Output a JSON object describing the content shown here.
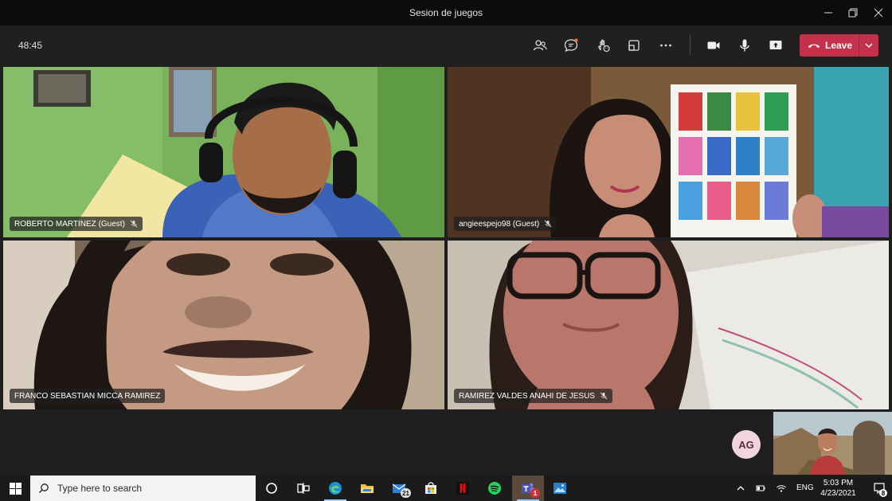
{
  "window": {
    "title": "Sesion de juegos",
    "controls": [
      "minimize-icon",
      "restore-icon",
      "close-icon"
    ]
  },
  "toolbar": {
    "timer": "48:45",
    "buttons": [
      "participants-icon",
      "chat-icon",
      "reactions-icon",
      "rooms-icon",
      "more-icon",
      "camera-icon",
      "mic-icon",
      "share-icon"
    ],
    "leave_label": "Leave",
    "leave_color": "#c4314b"
  },
  "participants": [
    {
      "name": "ROBERTO MARTINEZ (Guest)",
      "muted": true
    },
    {
      "name": "angieespejo98 (Guest)",
      "muted": true
    },
    {
      "name": "FRANCO SEBASTIAN MICCA RAMIREZ",
      "muted": false
    },
    {
      "name": "RAMIREZ VALDES ANAHI DE JESUS",
      "muted": true
    }
  ],
  "avatar": {
    "initials": "AG",
    "color": "#f1d4df"
  },
  "taskbar": {
    "search_placeholder": "Type here to search",
    "apps": [
      "task-view-icon",
      "edge-icon",
      "file-explorer-icon",
      "mail-icon",
      "store-icon",
      "netflix-icon",
      "spotify-icon",
      "teams-icon",
      "photos-icon"
    ],
    "mail_badge": "21",
    "teams_badge": "1",
    "language": "ENG",
    "time": "5:03 PM",
    "date": "4/23/2021",
    "notification_count": "8"
  }
}
